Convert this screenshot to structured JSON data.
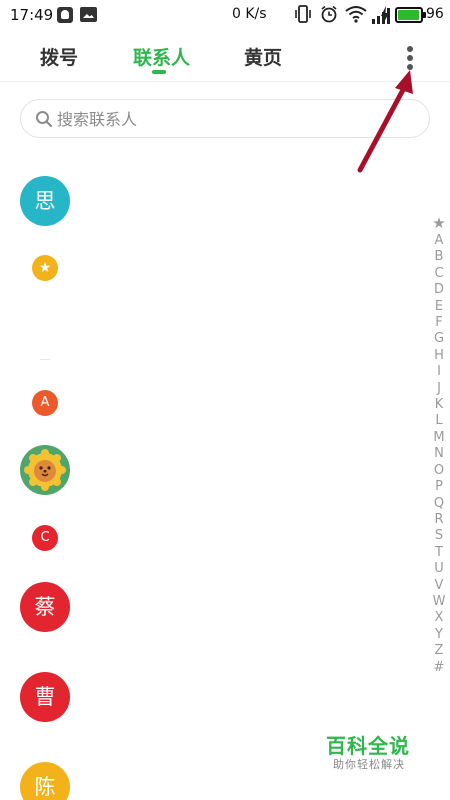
{
  "status_bar": {
    "time": "17:49",
    "net_speed": "0 K/s",
    "battery_level": "96",
    "icons": [
      "notification-icon",
      "image-icon",
      "vibrate-icon",
      "alarm-icon",
      "wifi-icon",
      "cell-signal-icon",
      "charging-icon",
      "battery-icon"
    ],
    "battery_color": "#2eb82e"
  },
  "tabs": {
    "items": [
      {
        "label": "拨号",
        "active": false
      },
      {
        "label": "联系人",
        "active": true
      },
      {
        "label": "黄页",
        "active": false
      }
    ],
    "active_color": "#2fb64d"
  },
  "search": {
    "placeholder": "搜索联系人",
    "value": ""
  },
  "contacts": {
    "avatar_si": "思",
    "section_star": "★",
    "section_a": "A",
    "section_c": "C",
    "avatar_cai": "蔡",
    "avatar_cao": "曹",
    "avatar_chen": "陈",
    "colors": {
      "teal": "#26b6c7",
      "yellow": "#f3b21b",
      "orange": "#ec5a2b",
      "red": "#e3252f",
      "green": "#4fa56a"
    }
  },
  "alphabet_index": [
    "★",
    "A",
    "B",
    "C",
    "D",
    "E",
    "F",
    "G",
    "H",
    "I",
    "J",
    "K",
    "L",
    "M",
    "N",
    "O",
    "P",
    "Q",
    "R",
    "S",
    "T",
    "U",
    "V",
    "W",
    "X",
    "Y",
    "Z",
    "#"
  ],
  "watermark": {
    "title": "百科全说",
    "subtitle": "助你轻松解决"
  },
  "annotation": {
    "arrow_color": "#a8102a"
  }
}
